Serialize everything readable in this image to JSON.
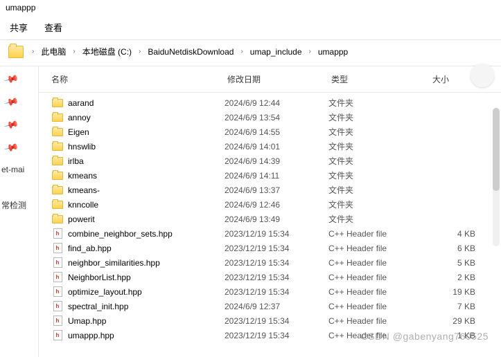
{
  "window": {
    "title": "umappp"
  },
  "ribbon": {
    "tab1": "共享",
    "tab2": "查看"
  },
  "breadcrumb": {
    "items": [
      "此电脑",
      "本地磁盘 (C:)",
      "BaiduNetdiskDownload",
      "umap_include",
      "umappp"
    ]
  },
  "sidebar": {
    "label1": "et-mai",
    "label2": "常检测"
  },
  "headers": {
    "name": "名称",
    "date": "修改日期",
    "type": "类型",
    "size": "大小"
  },
  "type_labels": {
    "folder": "文件夹",
    "hpp": "C++ Header file"
  },
  "files": [
    {
      "icon": "folder",
      "name": "aarand",
      "date": "2024/6/9 12:44",
      "type": "folder",
      "size": ""
    },
    {
      "icon": "folder",
      "name": "annoy",
      "date": "2024/6/9 13:54",
      "type": "folder",
      "size": ""
    },
    {
      "icon": "folder",
      "name": "Eigen",
      "date": "2024/6/9 14:55",
      "type": "folder",
      "size": ""
    },
    {
      "icon": "folder",
      "name": "hnswlib",
      "date": "2024/6/9 14:01",
      "type": "folder",
      "size": ""
    },
    {
      "icon": "folder",
      "name": "irlba",
      "date": "2024/6/9 14:39",
      "type": "folder",
      "size": ""
    },
    {
      "icon": "folder",
      "name": "kmeans",
      "date": "2024/6/9 14:11",
      "type": "folder",
      "size": ""
    },
    {
      "icon": "folder",
      "name": "kmeans-",
      "date": "2024/6/9 13:37",
      "type": "folder",
      "size": ""
    },
    {
      "icon": "folder",
      "name": "knncolle",
      "date": "2024/6/9 12:46",
      "type": "folder",
      "size": ""
    },
    {
      "icon": "folder",
      "name": "powerit",
      "date": "2024/6/9 13:49",
      "type": "folder",
      "size": ""
    },
    {
      "icon": "hpp",
      "name": "combine_neighbor_sets.hpp",
      "date": "2023/12/19 15:34",
      "type": "hpp",
      "size": "4 KB"
    },
    {
      "icon": "hpp",
      "name": "find_ab.hpp",
      "date": "2023/12/19 15:34",
      "type": "hpp",
      "size": "6 KB"
    },
    {
      "icon": "hpp",
      "name": "neighbor_similarities.hpp",
      "date": "2023/12/19 15:34",
      "type": "hpp",
      "size": "5 KB"
    },
    {
      "icon": "hpp",
      "name": "NeighborList.hpp",
      "date": "2023/12/19 15:34",
      "type": "hpp",
      "size": "2 KB"
    },
    {
      "icon": "hpp",
      "name": "optimize_layout.hpp",
      "date": "2023/12/19 15:34",
      "type": "hpp",
      "size": "19 KB"
    },
    {
      "icon": "hpp",
      "name": "spectral_init.hpp",
      "date": "2024/6/9 12:37",
      "type": "hpp",
      "size": "7 KB"
    },
    {
      "icon": "hpp",
      "name": "Umap.hpp",
      "date": "2023/12/19 15:34",
      "type": "hpp",
      "size": "29 KB"
    },
    {
      "icon": "hpp",
      "name": "umappp.hpp",
      "date": "2023/12/19 15:34",
      "type": "hpp",
      "size": "1 KB"
    }
  ],
  "watermark": "CSDN @gabenyang760525"
}
